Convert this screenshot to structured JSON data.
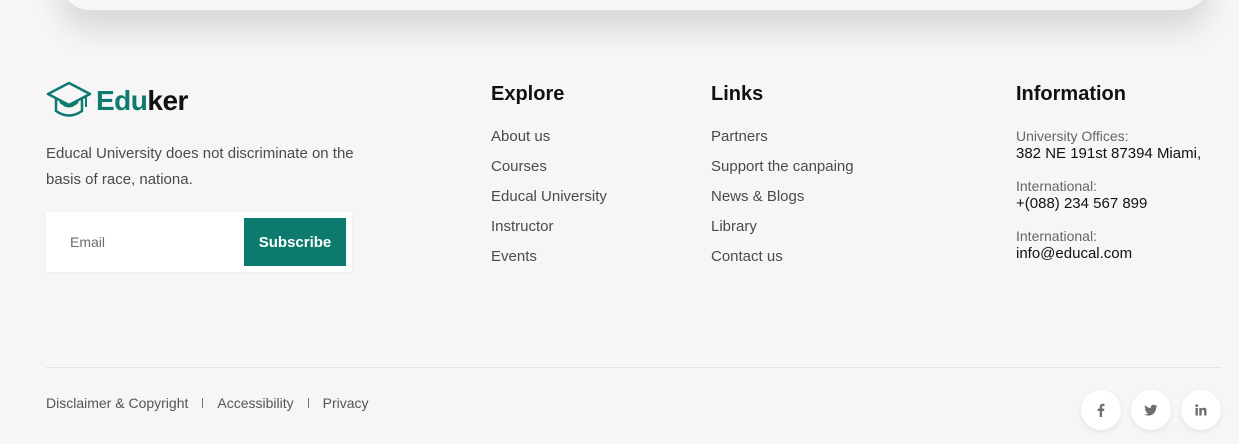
{
  "brand": {
    "name_accent": "Edu",
    "name_rest": "ker",
    "accent_color": "#0d7a6e"
  },
  "about": {
    "text": "Educal University does not discriminate on the basis of race, nationa."
  },
  "subscribe": {
    "placeholder": "Email",
    "button_label": "Subscribe"
  },
  "explore": {
    "title": "Explore",
    "items": [
      "About us",
      "Courses",
      "Educal University",
      "Instructor",
      "Events"
    ]
  },
  "links": {
    "title": "Links",
    "items": [
      "Partners",
      "Support the canpaing",
      "News & Blogs",
      "Library",
      "Contact us"
    ]
  },
  "information": {
    "title": "Information",
    "items": [
      {
        "label": "University Offices:",
        "value": "382 NE 191st 87394 Miami,"
      },
      {
        "label": "International:",
        "value": "+(088) 234 567 899"
      },
      {
        "label": "International:",
        "value": "info@educal.com"
      }
    ]
  },
  "bottom": {
    "links": [
      "Disclaimer & Copyright",
      "Accessibility",
      "Privacy"
    ]
  },
  "social": {
    "icons": [
      "facebook-icon",
      "twitter-icon",
      "linkedin-icon"
    ]
  }
}
